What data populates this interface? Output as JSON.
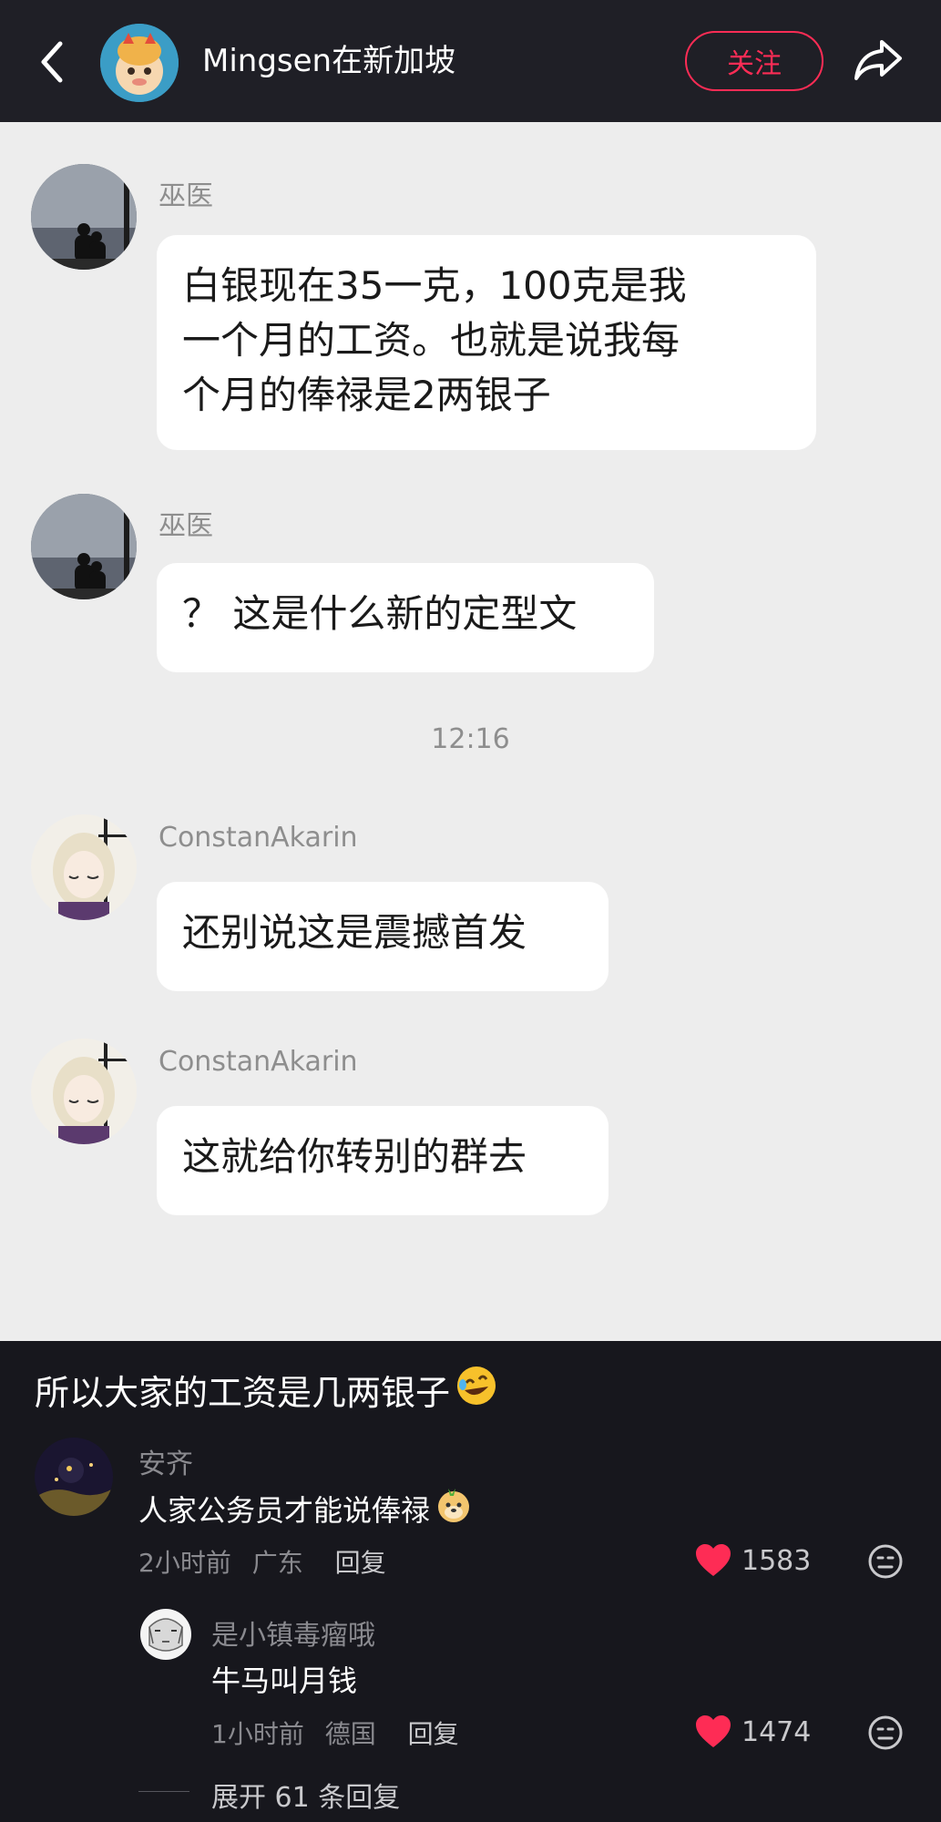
{
  "header": {
    "title": "Mingsen在新加坡",
    "follow_label": "关注",
    "icons": [
      "back-arrow-icon",
      "share-arrow-icon"
    ]
  },
  "chat": {
    "messages": [
      {
        "user": "巫医",
        "lines": [
          "白银现在35一克，100克是我",
          "一个月的工资。也就是说我每",
          "个月的俸禄是2两银子"
        ]
      },
      {
        "user": "巫医",
        "lines": [
          "？ 这是什么新的定型文"
        ]
      },
      {
        "user": "ConstanAkarin",
        "lines": [
          "还别说这是震撼首发"
        ]
      },
      {
        "user": "ConstanAkarin",
        "lines": [
          "这就给你转别的群去"
        ]
      }
    ],
    "timestamp": "12:16"
  },
  "post": {
    "caption": "所以大家的工资是几两银子"
  },
  "comments": [
    {
      "user": "安齐",
      "text": "人家公务员才能说俸禄",
      "time": "2小时前",
      "location": "广东",
      "reply_label": "回复",
      "likes": "1583"
    },
    {
      "user": "是小镇毒瘤哦",
      "text": "牛马叫月钱",
      "time": "1小时前",
      "location": "德国",
      "reply_label": "回复",
      "likes": "1474"
    }
  ],
  "expand_label": "展开 61 条回复",
  "colors": {
    "accent": "#fe2c55",
    "chat_bg": "#ededed",
    "bubble": "#ffffff",
    "dark_bg": "#17171d",
    "like_heart": "#fe2c55"
  }
}
